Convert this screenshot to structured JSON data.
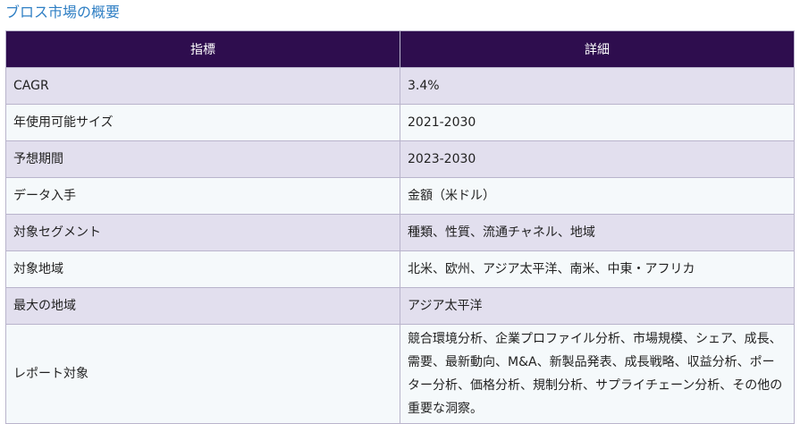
{
  "title": "ブロス市場の概要",
  "table": {
    "headers": [
      "指標",
      "詳細"
    ],
    "rows": [
      {
        "metric": "CAGR",
        "detail": "3.4%"
      },
      {
        "metric": "年使用可能サイズ",
        "detail": "2021-2030"
      },
      {
        "metric": "予想期間",
        "detail": "2023-2030"
      },
      {
        "metric": "データ入手",
        "detail": "金額（米ドル）"
      },
      {
        "metric": "対象セグメント",
        "detail": "種類、性質、流通チャネル、地域"
      },
      {
        "metric": "対象地域",
        "detail": "北米、欧州、アジア太平洋、南米、中東・アフリカ"
      },
      {
        "metric": "最大の地域",
        "detail": "アジア太平洋"
      },
      {
        "metric": "レポート対象",
        "detail": "競合環境分析、企業プロファイル分析、市場規模、シェア、成長、需要、最新動向、M&A、新製品発表、成長戦略、収益分析、ポーター分析、価格分析、規制分析、サプライチェーン分析、その他の重要な洞察。"
      }
    ]
  },
  "colors": {
    "title": "#2f7fc4",
    "header_bg": "#2e0d4e",
    "header_text": "#ffffff",
    "row_odd": "#e2dfee",
    "row_even": "#f5f9fb",
    "border": "#b9b4cc"
  }
}
